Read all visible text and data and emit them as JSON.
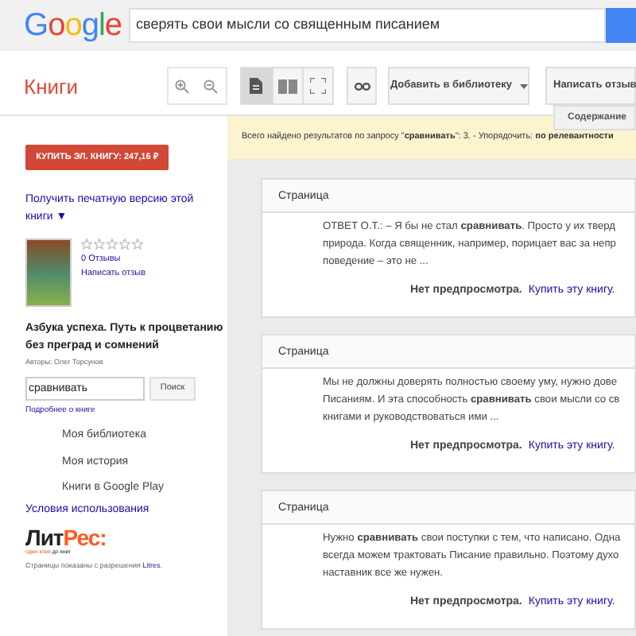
{
  "header": {
    "logo": "Google",
    "query": "сверять свои мысли со священным писанием"
  },
  "toolbar": {
    "section": "Книги",
    "views": [
      {
        "kind": "single",
        "selected": true
      },
      {
        "kind": "double",
        "selected": false
      },
      {
        "kind": "fullscreen",
        "selected": false
      }
    ],
    "add_library": "Добавить в библиотеку",
    "review": "Написать отзыв",
    "contents": "Содержание"
  },
  "sidebar": {
    "buy": "КУПИТЬ ЭЛ. КНИГУ: 247,16 ₽",
    "print_link": "Получить печатную версию этой книги ▼",
    "stars": 0,
    "reviews": "0 Отзывы",
    "write_review": "Написать отзыв",
    "title": "Азбука успеха. Путь к процветанию без преград и сомнений",
    "authors": "Авторы: Олег Торсунов",
    "search_value": "сравнивать",
    "search_button": "Поиск",
    "about": "Подробнее о книге",
    "menu": [
      "Моя библиотека",
      "Моя история",
      "Книги в Google Play"
    ],
    "terms": "Условия использования",
    "litres_logo": [
      "Лит",
      "Рес:"
    ],
    "litres_tagline": [
      "один клик",
      "до книг"
    ],
    "permission": "Страницы показаны с разрешения ",
    "permission_link": "Litres",
    "permission_end": "."
  },
  "notice": "Всего найдено результатов по запросу \"**сравнивать**\": 3. - Упорядочить: **по релевантности**",
  "results": [
    {
      "heading": "Страница",
      "lines": [
        "ОТВЕТ О.Т.: – Я бы не стал **сравнивать**. Просто у их тверд",
        "природа. Когда священник, например, порицает вас за непр",
        "поведение – это не ..."
      ],
      "no_preview": "Нет предпросмотра.",
      "buy_link": "Купить эту книгу."
    },
    {
      "heading": "Страница",
      "lines": [
        "Мы не должны доверять полностью своему уму, нужно дове",
        "Писаниям. И эта способность **сравнивать** свои мысли со св",
        "книгами и руководствоваться ими ..."
      ],
      "no_preview": "Нет предпросмотра.",
      "buy_link": "Купить эту книгу."
    },
    {
      "heading": "Страница",
      "lines": [
        "Нужно **сравнивать** свои поступки с тем, что написано. Одна",
        "всегда можем трактовать Писание правильно. Поэтому духо",
        "наставник все же нужен."
      ],
      "no_preview": "Нет предпросмотра.",
      "buy_link": "Купить эту книгу."
    }
  ]
}
